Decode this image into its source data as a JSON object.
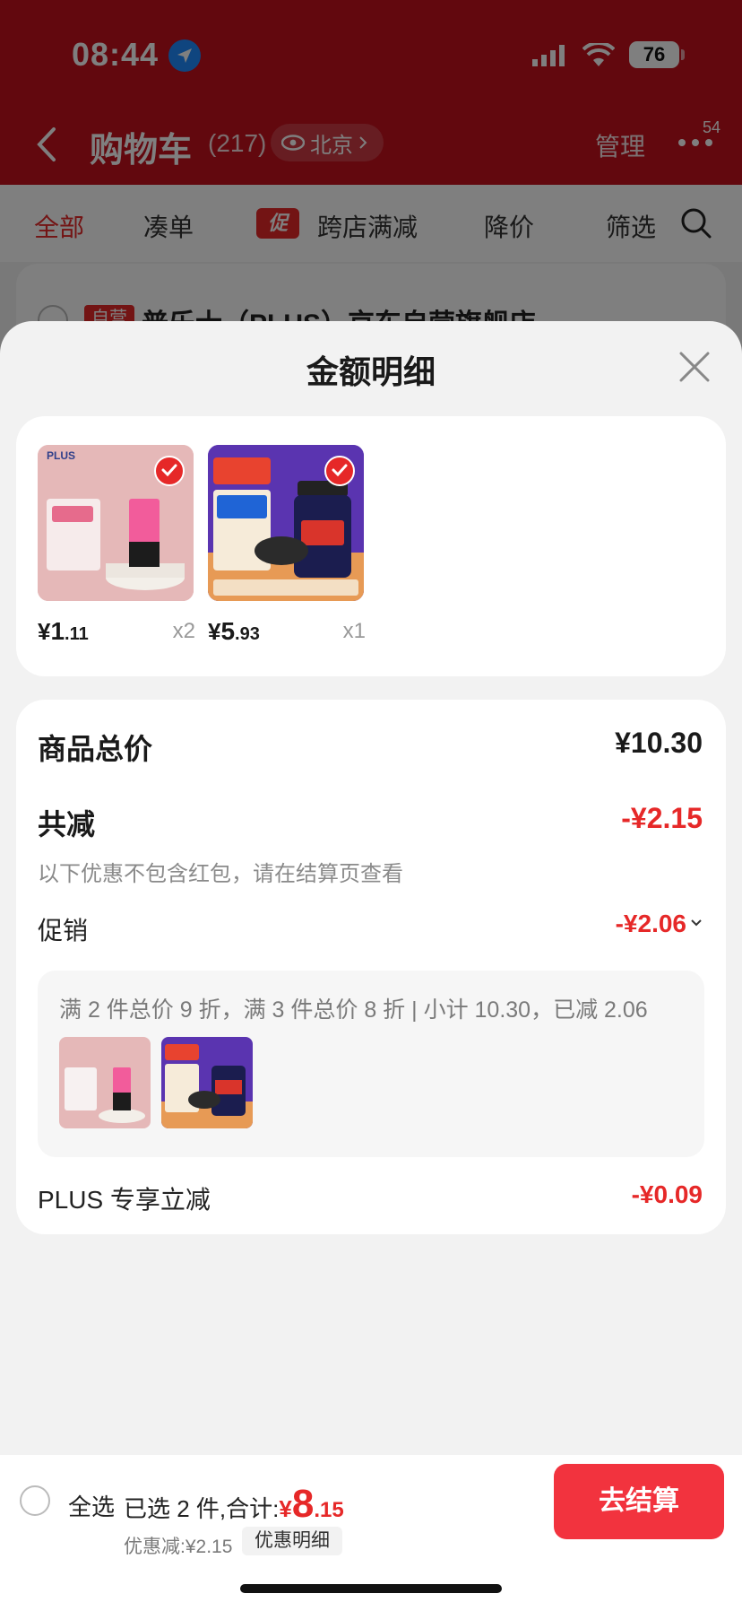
{
  "status": {
    "time": "08:44",
    "battery": "76"
  },
  "nav": {
    "title": "购物车",
    "count": "(217)",
    "location": "北京",
    "manage": "管理",
    "badge": "54"
  },
  "filters": {
    "all": "全部",
    "bundle": "凑单",
    "promo_tag": "促",
    "cross_store": "跨店满减",
    "price_drop": "降价",
    "filter": "筛选"
  },
  "store": {
    "tag": "自营",
    "name": "普乐士（PLUS）京东自营旗舰店"
  },
  "sheet": {
    "title": "金额明细",
    "items": [
      {
        "price_yen": "¥",
        "price_int": "1",
        "price_dec": ".11",
        "qty": "x2"
      },
      {
        "price_yen": "¥",
        "price_int": "5",
        "price_dec": ".93",
        "qty": "x1"
      }
    ],
    "summary": {
      "total_label": "商品总价",
      "total_value": "¥10.30",
      "reduce_label": "共减",
      "reduce_value": "-¥2.15",
      "note": "以下优惠不包含红包，请在结算页查看",
      "promo_label": "促销",
      "promo_value": "-¥2.06",
      "promo_desc": "满 2 件总价 9 折，满 3 件总价 8 折 | 小计 10.30，已减 2.06",
      "plus_label": "PLUS 专享立减",
      "plus_value": "-¥0.09"
    }
  },
  "bottom": {
    "select_all": "全选",
    "total_prefix": "已选 2 件,合计:",
    "total_yen": "¥",
    "total_int": "8",
    "total_dec": ".15",
    "discount": "优惠减:¥2.15",
    "detail_button": "优惠明细",
    "checkout": "去结算"
  },
  "colors": {
    "header": "#c4101c",
    "accent": "#e62828",
    "checkout": "#f2333e"
  }
}
